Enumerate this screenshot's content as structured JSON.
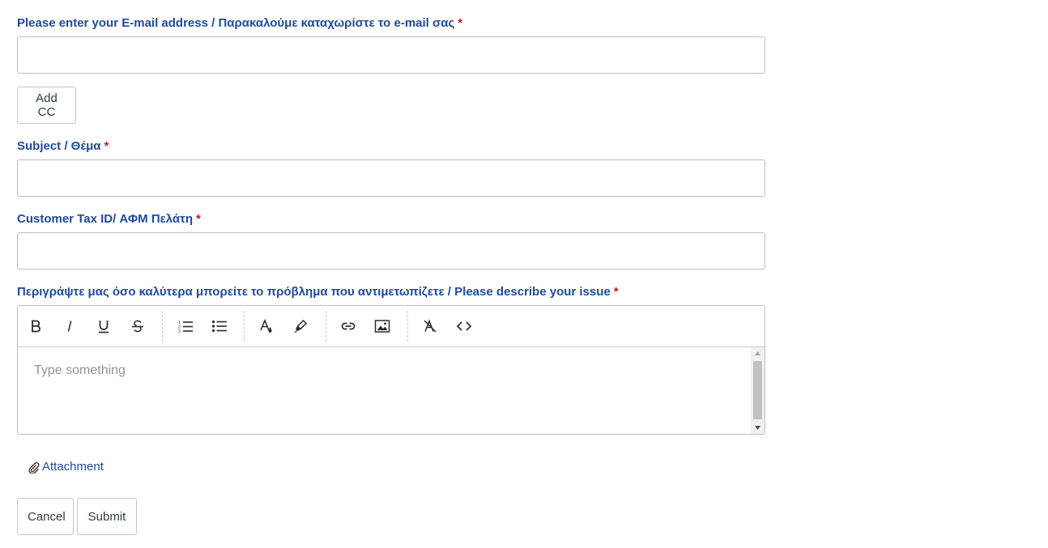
{
  "form": {
    "email": {
      "label": "Please enter your E-mail address / Παρακαλούμε καταχωρίστε το e-mail σας",
      "required_mark": "*",
      "value": ""
    },
    "add_cc_label": "Add CC",
    "subject": {
      "label": "Subject / Θέμα",
      "required_mark": "*",
      "value": ""
    },
    "tax_id": {
      "label": "Customer Tax ID/ ΑΦΜ Πελάτη",
      "required_mark": "*",
      "value": ""
    },
    "description": {
      "label": "Περιγράψτε μας όσο καλύτερα μπορείτε το πρόβλημα που αντιμετωπίζετε / Please describe your issue",
      "required_mark": "*",
      "placeholder": "Type something"
    },
    "toolbar": {
      "icons": [
        "bold-icon",
        "italic-icon",
        "underline-icon",
        "strikethrough-icon",
        "ordered-list-icon",
        "bullet-list-icon",
        "text-color-icon",
        "highlight-icon",
        "link-icon",
        "image-icon",
        "clear-format-icon",
        "code-icon"
      ]
    },
    "attachment_label": "Attachment",
    "cancel_label": "Cancel",
    "submit_label": "Submit"
  },
  "colors": {
    "label": "#1f4ba0",
    "required": "#c0172b",
    "border": "#b9bec6",
    "placeholder": "#8e949b"
  }
}
